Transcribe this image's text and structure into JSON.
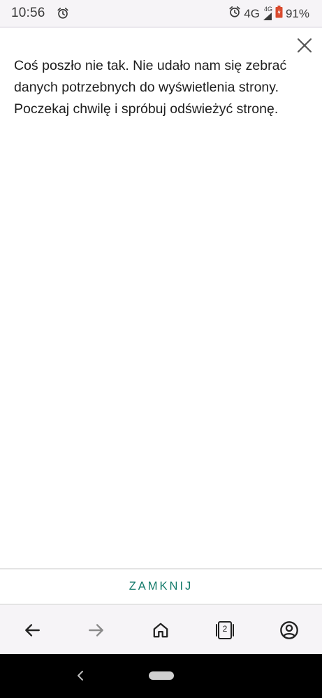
{
  "status_bar": {
    "time": "10:56",
    "network": "4G",
    "network_small": "4G",
    "battery_percent": "91%",
    "battery_level": 0.91
  },
  "dialog": {
    "message": "Coś poszło nie tak. Nie udało nam się zebrać danych potrzebnych do wyświetlenia strony. Poczekaj chwilę i spróbuj odświeżyć stronę.",
    "close_label": "ZAMKNIJ"
  },
  "bottom_nav": {
    "tabs_count": "2"
  },
  "colors": {
    "accent": "#137a6a",
    "battery": "#d94a2e"
  }
}
